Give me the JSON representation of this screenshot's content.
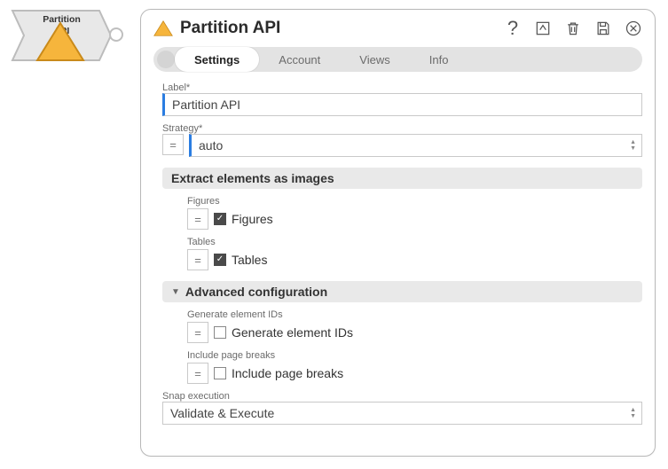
{
  "node": {
    "label_line1": "Partition",
    "label_line2": "API"
  },
  "panel": {
    "title": "Partition API"
  },
  "tabs": {
    "t0": "Settings",
    "t1": "Account",
    "t2": "Views",
    "t3": "Info"
  },
  "form": {
    "label_field_title": "Label*",
    "label_value": "Partition API",
    "strategy_title": "Strategy*",
    "strategy_value": "auto",
    "section_extract": "Extract elements as images",
    "figures_title": "Figures",
    "figures_label": "Figures",
    "tables_title": "Tables",
    "tables_label": "Tables",
    "section_advanced": "Advanced configuration",
    "genids_title": "Generate element IDs",
    "genids_label": "Generate element IDs",
    "pagebreaks_title": "Include page breaks",
    "pagebreaks_label": "Include page breaks",
    "snap_title": "Snap execution",
    "snap_value": "Validate & Execute"
  }
}
